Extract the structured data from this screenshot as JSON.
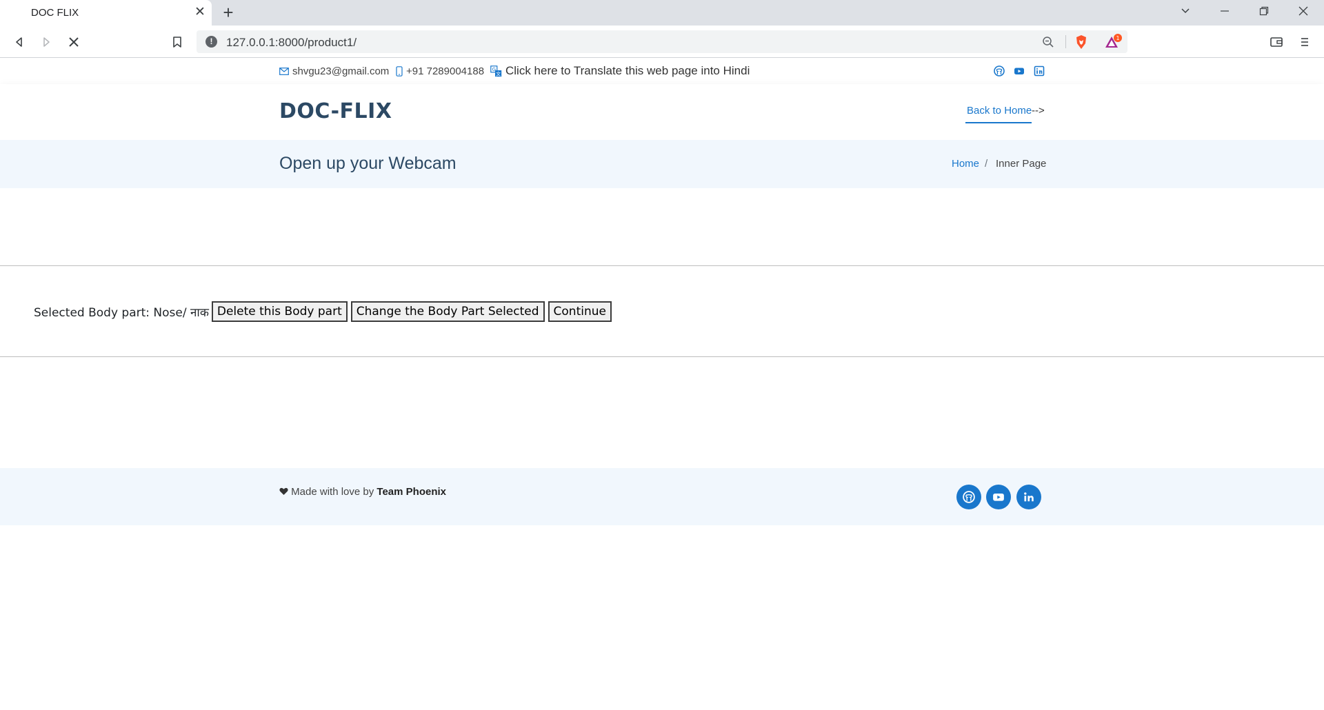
{
  "browser": {
    "tab_title": "DOC FLIX",
    "url": "127.0.0.1:8000/product1/"
  },
  "topbar": {
    "email": "shvgu23@gmail.com",
    "phone": "+91 7289004188",
    "translate": "Click here to Translate this web page into Hindi"
  },
  "header": {
    "logo": "DOC-FLIX",
    "back_link": "Back to Home",
    "back_arrow": "-->"
  },
  "breadcrumbs": {
    "title": "Open up your Webcam",
    "home": "Home",
    "separator": "/",
    "current": "Inner Page"
  },
  "content": {
    "selected_label": "Selected Body part: Nose/ नाक",
    "delete_button": "Delete this Body part",
    "change_button": "Change the Body Part Selected",
    "continue_button": "Continue"
  },
  "footer": {
    "made_with": "Made with love by",
    "team": "Team Phoenix"
  },
  "colors": {
    "accent": "#1977cc",
    "heading": "#2c4964",
    "band": "#f1f7fd"
  }
}
